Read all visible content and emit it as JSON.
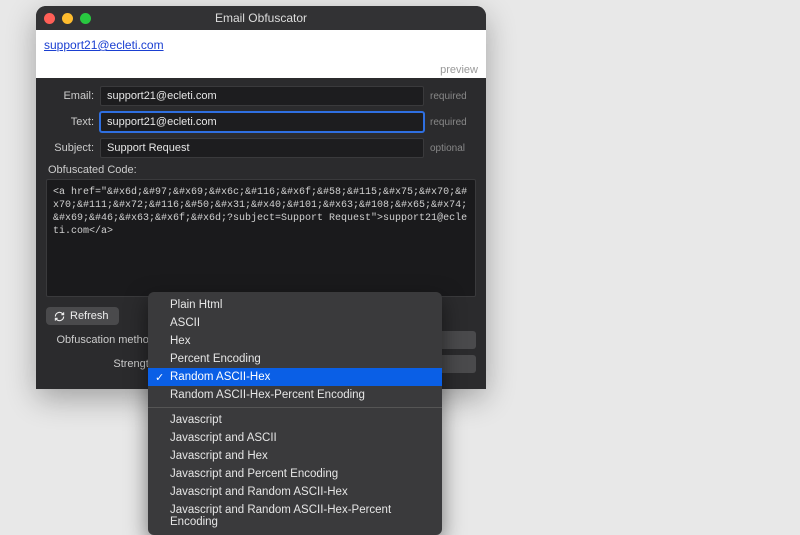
{
  "window": {
    "title": "Email Obfuscator"
  },
  "preview": {
    "link_text": "support21@ecleti.com",
    "label": "preview"
  },
  "fields": {
    "email": {
      "label": "Email:",
      "value": "support21@ecleti.com",
      "hint": "required"
    },
    "text": {
      "label": "Text:",
      "value": "support21@ecleti.com",
      "hint": "required"
    },
    "subject": {
      "label": "Subject:",
      "value": "Support Request",
      "hint": "optional"
    }
  },
  "obfuscated": {
    "label": "Obfuscated Code:",
    "code": "<a href=\"&#x6d;&#97;&#x69;&#x6c;&#116;&#x6f;&#58;&#115;&#x75;&#x70;&#x70;&#111;&#x72;&#116;&#50;&#x31;&#x40;&#101;&#x63;&#108;&#x65;&#x74;&#x69;&#46;&#x63;&#x6f;&#x6d;?subject=Support Request\">support21@ecleti.com</a>"
  },
  "controls": {
    "refresh": "Refresh",
    "method_label": "Obfuscation method:",
    "strength_label": "Strength:"
  },
  "dropdown": {
    "groups": [
      [
        "Plain Html",
        "ASCII",
        "Hex",
        "Percent Encoding",
        "Random ASCII-Hex",
        "Random ASCII-Hex-Percent Encoding"
      ],
      [
        "Javascript",
        "Javascript and ASCII",
        "Javascript and Hex",
        "Javascript and Percent Encoding",
        "Javascript and Random ASCII-Hex",
        "Javascript and Random ASCII-Hex-Percent Encoding"
      ]
    ],
    "selected": "Random ASCII-Hex"
  }
}
